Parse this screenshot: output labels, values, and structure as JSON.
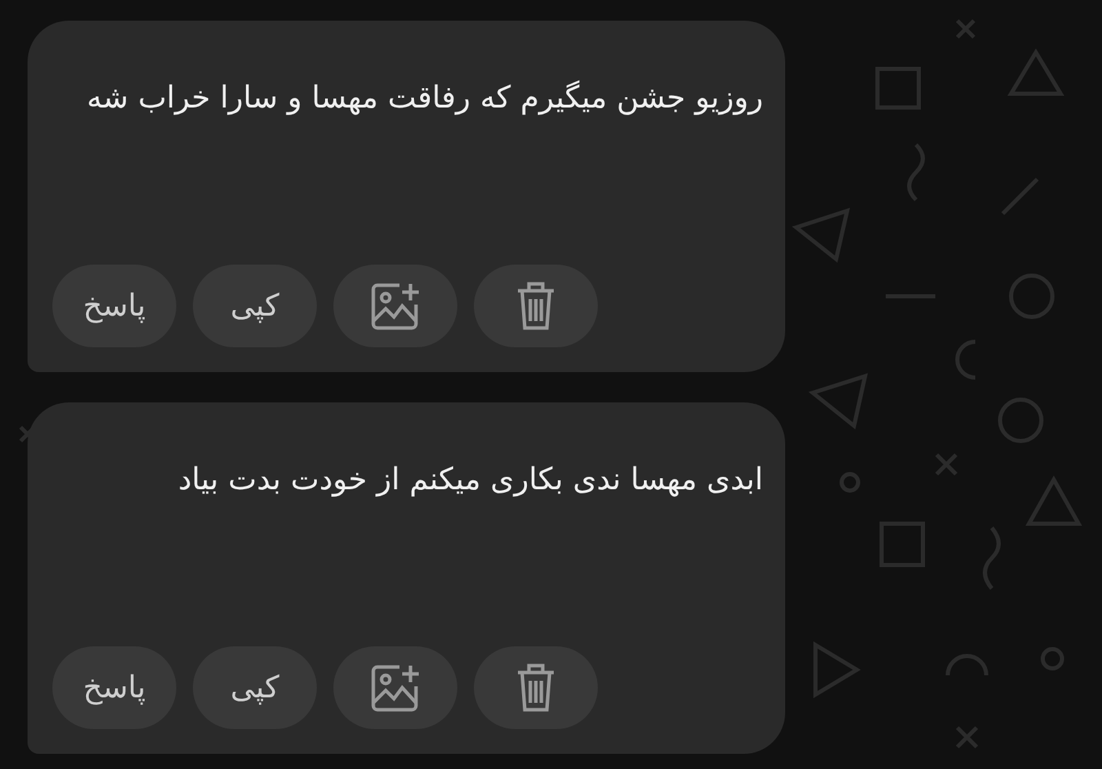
{
  "messages": [
    {
      "text": "روزیو جشن میگیرم که رفاقت مهسا و سارا خراب شه",
      "actions": [
        {
          "kind": "delete"
        },
        {
          "kind": "add-image"
        },
        {
          "kind": "copy",
          "label": "کپی"
        },
        {
          "kind": "reply",
          "label": "پاسخ"
        }
      ]
    },
    {
      "text": "ابدی مهسا ندی بکاری میکنم از خودت بدت بیاد",
      "actions": [
        {
          "kind": "delete"
        },
        {
          "kind": "add-image"
        },
        {
          "kind": "copy",
          "label": "کپی"
        },
        {
          "kind": "reply",
          "label": "پاسخ"
        }
      ]
    }
  ]
}
